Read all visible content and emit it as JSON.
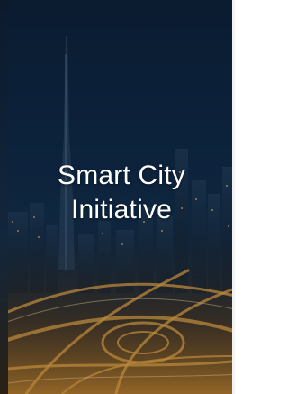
{
  "hero": {
    "title_line1": "Smart City",
    "title_line2": "Initiative",
    "image": "city-skyline-night-photo"
  },
  "colors": {
    "sky_top": "#0b1d33",
    "sky_mid": "#102a45",
    "ground_glow": "#c8852a",
    "text": "#ffffff"
  }
}
